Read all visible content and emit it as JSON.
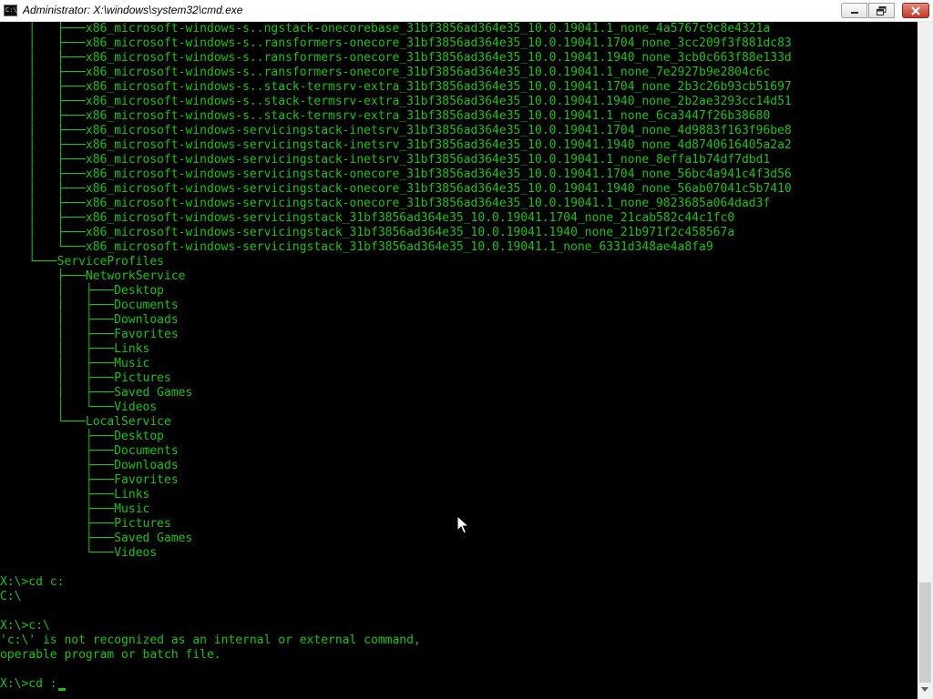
{
  "window": {
    "title": "Administrator: X:\\windows\\system32\\cmd.exe",
    "icon_text": "C:\\"
  },
  "colors": {
    "console_text": "#16c60c",
    "console_background": "#000000",
    "close_button": "#c4392a"
  },
  "icons": {
    "app": "cmd-icon",
    "minimize": "minimize-icon",
    "maximize": "maximize-icon",
    "close": "close-icon"
  },
  "console": {
    "lines": [
      "    │   ├───x86_microsoft-windows-s..ngstack-onecorebase_31bf3856ad364e35_10.0.19041.1_none_4a5767c9c8e4321a",
      "    │   ├───x86_microsoft-windows-s..ransformers-onecore_31bf3856ad364e35_10.0.19041.1704_none_3cc209f3f881dc83",
      "    │   ├───x86_microsoft-windows-s..ransformers-onecore_31bf3856ad364e35_10.0.19041.1940_none_3cb0c663f88e133d",
      "    │   ├───x86_microsoft-windows-s..ransformers-onecore_31bf3856ad364e35_10.0.19041.1_none_7e2927b9e2804c6c",
      "    │   ├───x86_microsoft-windows-s..stack-termsrv-extra_31bf3856ad364e35_10.0.19041.1704_none_2b3c26b93cb51697",
      "    │   ├───x86_microsoft-windows-s..stack-termsrv-extra_31bf3856ad364e35_10.0.19041.1940_none_2b2ae3293cc14d51",
      "    │   ├───x86_microsoft-windows-s..stack-termsrv-extra_31bf3856ad364e35_10.0.19041.1_none_6ca3447f26b38680",
      "    │   ├───x86_microsoft-windows-servicingstack-inetsrv_31bf3856ad364e35_10.0.19041.1704_none_4d9883f163f96be8",
      "    │   ├───x86_microsoft-windows-servicingstack-inetsrv_31bf3856ad364e35_10.0.19041.1940_none_4d8740616405a2a2",
      "    │   ├───x86_microsoft-windows-servicingstack-inetsrv_31bf3856ad364e35_10.0.19041.1_none_8effa1b74df7dbd1",
      "    │   ├───x86_microsoft-windows-servicingstack-onecore_31bf3856ad364e35_10.0.19041.1704_none_56bc4a941c4f3d56",
      "    │   ├───x86_microsoft-windows-servicingstack-onecore_31bf3856ad364e35_10.0.19041.1940_none_56ab07041c5b7410",
      "    │   ├───x86_microsoft-windows-servicingstack-onecore_31bf3856ad364e35_10.0.19041.1_none_9823685a064dad3f",
      "    │   ├───x86_microsoft-windows-servicingstack_31bf3856ad364e35_10.0.19041.1704_none_21cab582c44c1fc0",
      "    │   ├───x86_microsoft-windows-servicingstack_31bf3856ad364e35_10.0.19041.1940_none_21b971f2c458567a",
      "    │   └───x86_microsoft-windows-servicingstack_31bf3856ad364e35_10.0.19041.1_none_6331d348ae4a8fa9",
      "    └───ServiceProfiles",
      "        ├───NetworkService",
      "        │   ├───Desktop",
      "        │   ├───Documents",
      "        │   ├───Downloads",
      "        │   ├───Favorites",
      "        │   ├───Links",
      "        │   ├───Music",
      "        │   ├───Pictures",
      "        │   ├───Saved Games",
      "        │   └───Videos",
      "        └───LocalService",
      "            ├───Desktop",
      "            ├───Documents",
      "            ├───Downloads",
      "            ├───Favorites",
      "            ├───Links",
      "            ├───Music",
      "            ├───Pictures",
      "            ├───Saved Games",
      "            └───Videos",
      "",
      "X:\\>cd c:",
      "C:\\",
      "",
      "X:\\>c:\\",
      "'c:\\' is not recognized as an internal or external command,",
      "operable program or batch file.",
      "",
      "X:\\>cd :"
    ]
  }
}
